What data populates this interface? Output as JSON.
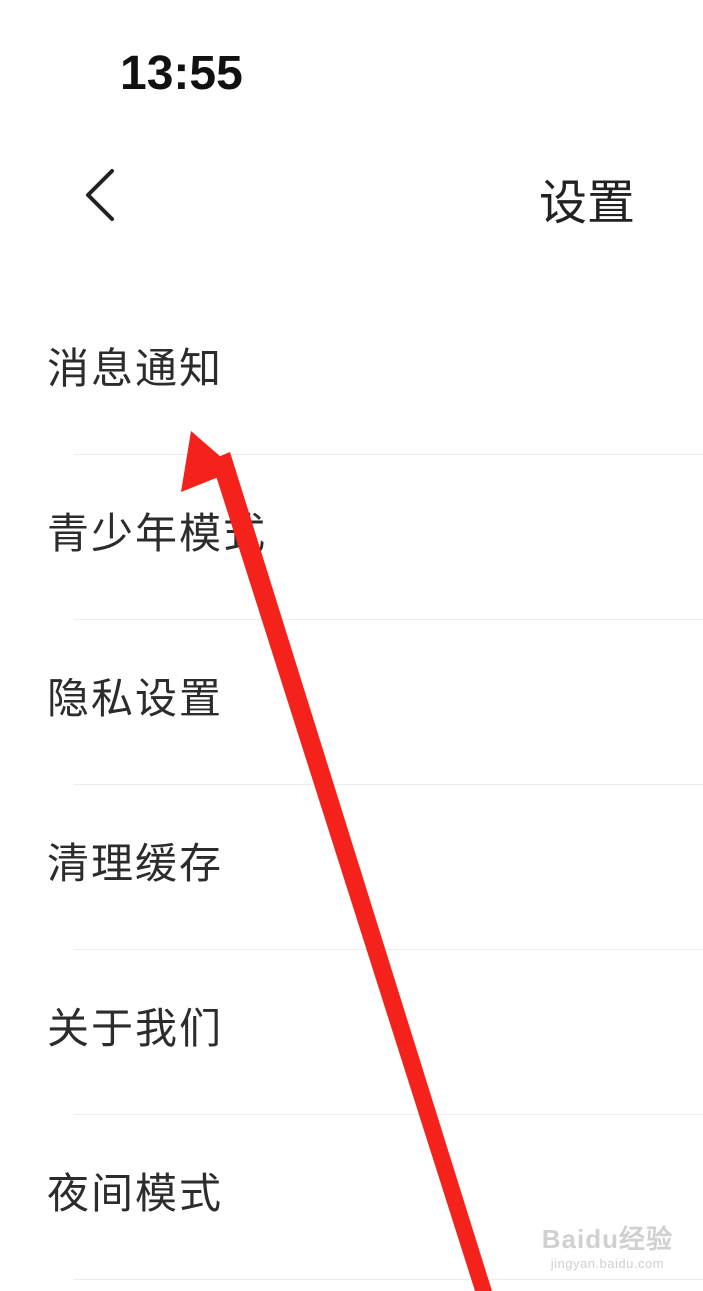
{
  "status_bar": {
    "time": "13:55"
  },
  "header": {
    "title": "设置",
    "back_icon": "chevron-left-icon"
  },
  "settings": {
    "items": [
      {
        "label": "消息通知"
      },
      {
        "label": "青少年模式"
      },
      {
        "label": "隐私设置"
      },
      {
        "label": "清理缓存"
      },
      {
        "label": "关于我们"
      },
      {
        "label": "夜间模式"
      }
    ]
  },
  "annotation": {
    "arrow_color": "#f5221b",
    "points_to": "消息通知"
  },
  "watermark": {
    "main": "Baidu经验",
    "sub": "jingyan.baidu.com"
  },
  "colors": {
    "background": "#ffffff",
    "text": "#2c2c2c",
    "divider": "#ececec"
  }
}
